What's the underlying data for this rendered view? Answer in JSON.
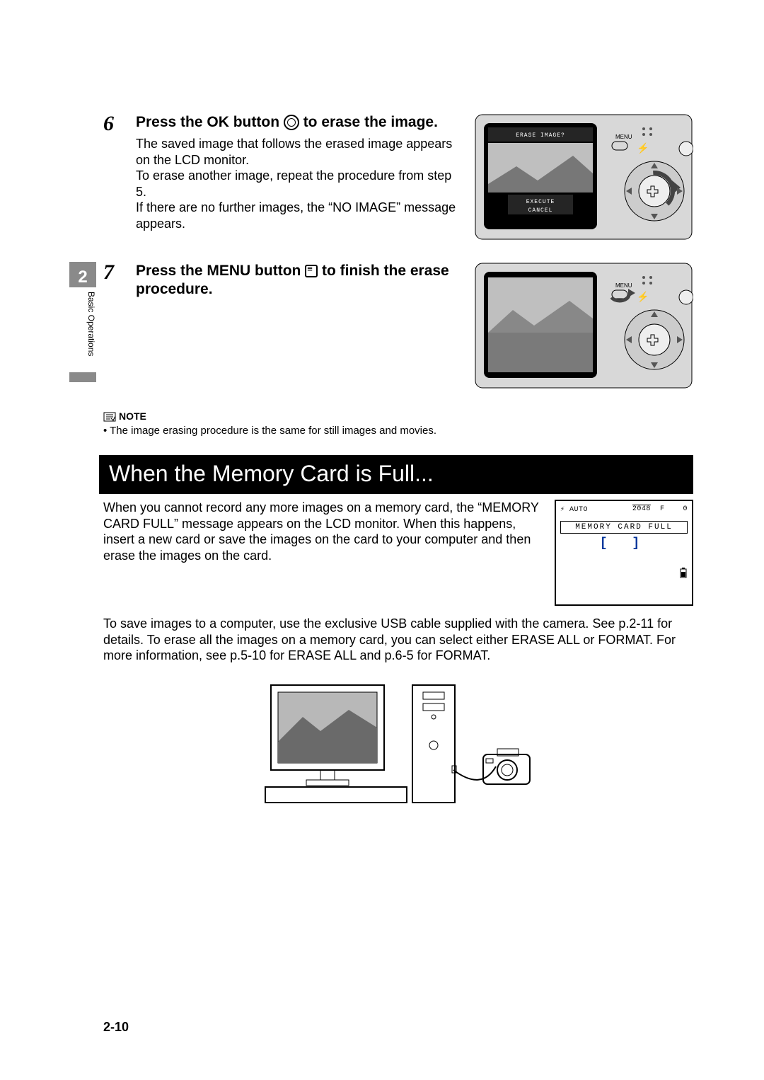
{
  "sidebar": {
    "chapter_number": "2",
    "chapter_title": "Basic Operations"
  },
  "step6": {
    "number": "6",
    "title_pre": "Press the OK button ",
    "title_post": " to erase the image.",
    "para": "The saved image that follows the erased image appears on the LCD monitor.\nTo erase another image, repeat the procedure from step 5.\nIf there are no further images, the “NO IMAGE” message appears.",
    "lcd": {
      "header": "ERASE IMAGE?",
      "option1": "EXECUTE",
      "option2": "CANCEL",
      "menu": "MENU"
    }
  },
  "step7": {
    "number": "7",
    "title_pre": "Press the MENU button ",
    "title_post": " to finish the erase procedure.",
    "lcd": {
      "menu": "MENU"
    }
  },
  "note": {
    "label": "NOTE",
    "text": "• The image erasing procedure is the same for still images and movies."
  },
  "memory_full": {
    "heading": "When the Memory Card is Full...",
    "para1": "When you cannot record any more images on a memory card, the “MEMORY CARD FULL” message appears on the LCD monitor. When this happens, insert a new card or save the images on the card to your computer and then erase the images on the card.",
    "lcd": {
      "flash": "⚡ AUTO",
      "size": "2048",
      "quality": "F",
      "count": "0",
      "message": "MEMORY CARD FULL",
      "brackets": "[   ]"
    },
    "para2": "To save images to a computer, use the exclusive USB cable supplied with the camera. See p.2-11 for details. To erase all the images on a memory card, you can select either ERASE ALL or FORMAT. For more information, see p.5-10 for ERASE ALL and p.6-5 for FORMAT."
  },
  "page_number": "2-10"
}
